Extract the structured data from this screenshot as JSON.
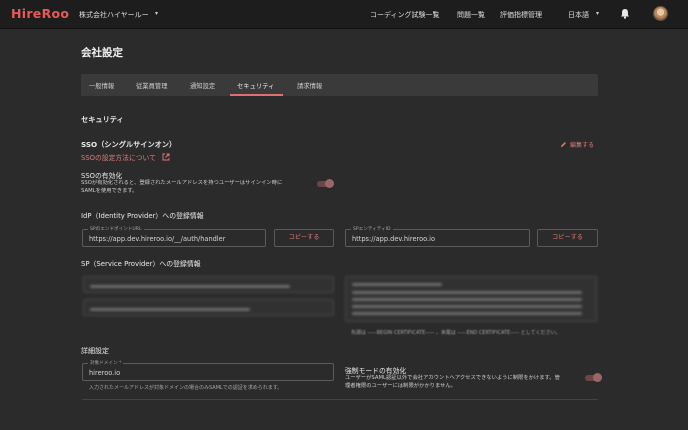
{
  "header": {
    "logo": "HireRoo",
    "company": "株式会社ハイヤールー",
    "nav": [
      "コーディング試験一覧",
      "問題一覧",
      "評価指標管理"
    ],
    "language": "日本語"
  },
  "page": {
    "title": "会社設定"
  },
  "tabs": [
    "一般情報",
    "従業員管理",
    "通知設定",
    "セキュリティ",
    "請求情報"
  ],
  "active_tab": "セキュリティ",
  "security": {
    "heading": "セキュリティ",
    "sso_title": "SSO（シングルサインオン）",
    "sso_link": "SSOの設定方法について",
    "edit_label": "編集する",
    "sso_enable_title": "SSOの有効化",
    "sso_enable_desc_1": "SSOが有効化されると、登録されたメールアドレスを持つユーザーはサインイン時に",
    "sso_enable_desc_2": "SAMLを使用できます。",
    "idp_heading": "IdP（Identity Provider）への登録情報",
    "idp_fields": [
      {
        "label": "SPのエンドポイントURL",
        "value": "https://app.dev.hireroo.io/__/auth/handler",
        "copy": "コピーする"
      },
      {
        "label": "SPエンティティID",
        "value": "https://app.dev.hireroo.io",
        "copy": "コピーする"
      }
    ],
    "sp_heading": "SP（Service Provider）への登録情報",
    "sp_cert_note": "先頭は -----BEGIN CERTIFICATE----- ，末尾は -----END CERTIFICATE----- としてください。",
    "advanced_heading": "詳細設定",
    "domain_label": "対象ドメイン *",
    "domain_value": "hireroo.io",
    "domain_helper": "入力されたメールアドレスが対象ドメインの場合のみSAMLでの認証を求められます。",
    "force_title": "強制モードの有効化",
    "force_desc_1": "ユーザーがSAML認証以外で会社アカウントへアクセスできないように制限をかけます。管",
    "force_desc_2": "理者権限のユーザーには制限がかかりません。"
  },
  "colors": {
    "accent": "#e07b7b",
    "logo": "#e85a5a",
    "background": "#2b2b2b",
    "topbar": "#1d1d1d"
  }
}
